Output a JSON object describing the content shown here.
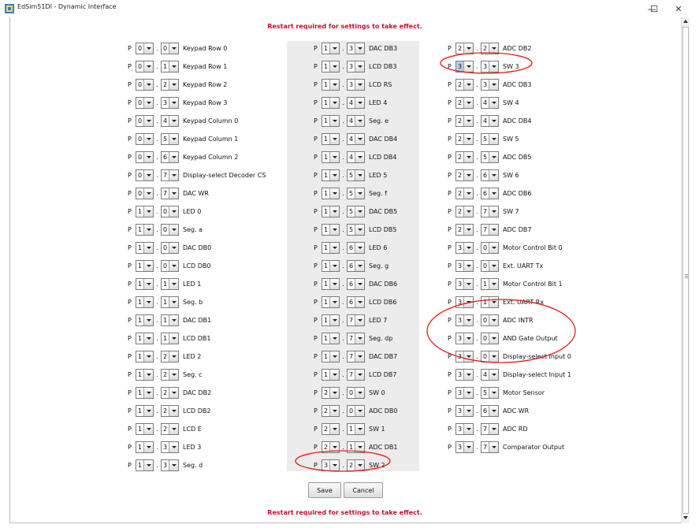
{
  "window": {
    "title": "EdSim51DI - Dynamic Interface",
    "minimize": "—",
    "maximize": "☐",
    "close": "✕"
  },
  "notice_top": "Restart required for settings to take effect.",
  "notice_bottom": "Restart required for settings to take effect.",
  "port_prefix": "P",
  "sep": ".",
  "columns": [
    [
      {
        "port": "0",
        "bit": "0",
        "label": "Keypad Row 0"
      },
      {
        "port": "0",
        "bit": "1",
        "label": "Keypad Row 1"
      },
      {
        "port": "0",
        "bit": "2",
        "label": "Keypad Row 2"
      },
      {
        "port": "0",
        "bit": "3",
        "label": "Keypad Row 3"
      },
      {
        "port": "0",
        "bit": "4",
        "label": "Keypad Column 0"
      },
      {
        "port": "0",
        "bit": "5",
        "label": "Keypad Column 1"
      },
      {
        "port": "0",
        "bit": "6",
        "label": "Keypad Column 2"
      },
      {
        "port": "0",
        "bit": "7",
        "label": "Display-select Decoder CS"
      },
      {
        "port": "0",
        "bit": "7",
        "label": "DAC WR"
      },
      {
        "port": "1",
        "bit": "0",
        "label": "LED 0"
      },
      {
        "port": "1",
        "bit": "0",
        "label": "Seg. a"
      },
      {
        "port": "1",
        "bit": "0",
        "label": "DAC DB0"
      },
      {
        "port": "1",
        "bit": "0",
        "label": "LCD DB0"
      },
      {
        "port": "1",
        "bit": "1",
        "label": "LED 1"
      },
      {
        "port": "1",
        "bit": "1",
        "label": "Seg. b"
      },
      {
        "port": "1",
        "bit": "1",
        "label": "DAC DB1"
      },
      {
        "port": "1",
        "bit": "1",
        "label": "LCD DB1"
      },
      {
        "port": "1",
        "bit": "2",
        "label": "LED 2"
      },
      {
        "port": "1",
        "bit": "2",
        "label": "Seg. c"
      },
      {
        "port": "1",
        "bit": "2",
        "label": "DAC DB2"
      },
      {
        "port": "1",
        "bit": "2",
        "label": "LCD DB2"
      },
      {
        "port": "1",
        "bit": "2",
        "label": "LCD E"
      },
      {
        "port": "1",
        "bit": "3",
        "label": "LED 3"
      },
      {
        "port": "1",
        "bit": "3",
        "label": "Seg. d"
      }
    ],
    [
      {
        "port": "1",
        "bit": "3",
        "label": "DAC DB3"
      },
      {
        "port": "1",
        "bit": "3",
        "label": "LCD DB3"
      },
      {
        "port": "1",
        "bit": "3",
        "label": "LCD RS"
      },
      {
        "port": "1",
        "bit": "4",
        "label": "LED 4"
      },
      {
        "port": "1",
        "bit": "4",
        "label": "Seg. e"
      },
      {
        "port": "1",
        "bit": "4",
        "label": "DAC DB4"
      },
      {
        "port": "1",
        "bit": "4",
        "label": "LCD DB4"
      },
      {
        "port": "1",
        "bit": "5",
        "label": "LED 5"
      },
      {
        "port": "1",
        "bit": "5",
        "label": "Seg. f"
      },
      {
        "port": "1",
        "bit": "5",
        "label": "DAC DB5"
      },
      {
        "port": "1",
        "bit": "5",
        "label": "LCD DB5"
      },
      {
        "port": "1",
        "bit": "6",
        "label": "LED 6"
      },
      {
        "port": "1",
        "bit": "6",
        "label": "Seg. g"
      },
      {
        "port": "1",
        "bit": "6",
        "label": "DAC DB6"
      },
      {
        "port": "1",
        "bit": "6",
        "label": "LCD DB6"
      },
      {
        "port": "1",
        "bit": "7",
        "label": "LED 7"
      },
      {
        "port": "1",
        "bit": "7",
        "label": "Seg. dp"
      },
      {
        "port": "1",
        "bit": "7",
        "label": "DAC DB7"
      },
      {
        "port": "1",
        "bit": "7",
        "label": "LCD DB7"
      },
      {
        "port": "2",
        "bit": "0",
        "label": "SW 0"
      },
      {
        "port": "2",
        "bit": "0",
        "label": "ADC DB0"
      },
      {
        "port": "2",
        "bit": "1",
        "label": "SW 1"
      },
      {
        "port": "2",
        "bit": "1",
        "label": "ADC DB1"
      },
      {
        "port": "3",
        "bit": "2",
        "label": "SW 2"
      }
    ],
    [
      {
        "port": "2",
        "bit": "2",
        "label": "ADC DB2"
      },
      {
        "port": "3",
        "bit": "3",
        "label": "SW 3",
        "selected": true
      },
      {
        "port": "2",
        "bit": "3",
        "label": "ADC DB3"
      },
      {
        "port": "2",
        "bit": "4",
        "label": "SW 4"
      },
      {
        "port": "2",
        "bit": "4",
        "label": "ADC DB4"
      },
      {
        "port": "2",
        "bit": "5",
        "label": "SW 5"
      },
      {
        "port": "2",
        "bit": "5",
        "label": "ADC DB5"
      },
      {
        "port": "2",
        "bit": "6",
        "label": "SW 6"
      },
      {
        "port": "2",
        "bit": "6",
        "label": "ADC DB6"
      },
      {
        "port": "2",
        "bit": "7",
        "label": "SW 7"
      },
      {
        "port": "2",
        "bit": "7",
        "label": "ADC DB7"
      },
      {
        "port": "3",
        "bit": "0",
        "label": "Motor Control Bit 0"
      },
      {
        "port": "3",
        "bit": "0",
        "label": "Ext. UART Tx"
      },
      {
        "port": "3",
        "bit": "1",
        "label": "Motor Control Bit 1"
      },
      {
        "port": "3",
        "bit": "1",
        "label": "Ext. UART Rx"
      },
      {
        "port": "3",
        "bit": "0",
        "label": "ADC INTR"
      },
      {
        "port": "3",
        "bit": "0",
        "label": "AND Gate Output"
      },
      {
        "port": "3",
        "bit": "0",
        "label": "Display-select Input 0"
      },
      {
        "port": "3",
        "bit": "4",
        "label": "Display-select Input 1"
      },
      {
        "port": "3",
        "bit": "5",
        "label": "Motor Sensor"
      },
      {
        "port": "3",
        "bit": "6",
        "label": "ADC WR"
      },
      {
        "port": "3",
        "bit": "7",
        "label": "ADC RD"
      },
      {
        "port": "3",
        "bit": "7",
        "label": "Comparator Output"
      }
    ]
  ],
  "buttons": {
    "save": "Save",
    "cancel": "Cancel"
  },
  "colors": {
    "notice": "#c8102e",
    "annotation": "#e0201e",
    "center_panel": "#ececec"
  }
}
